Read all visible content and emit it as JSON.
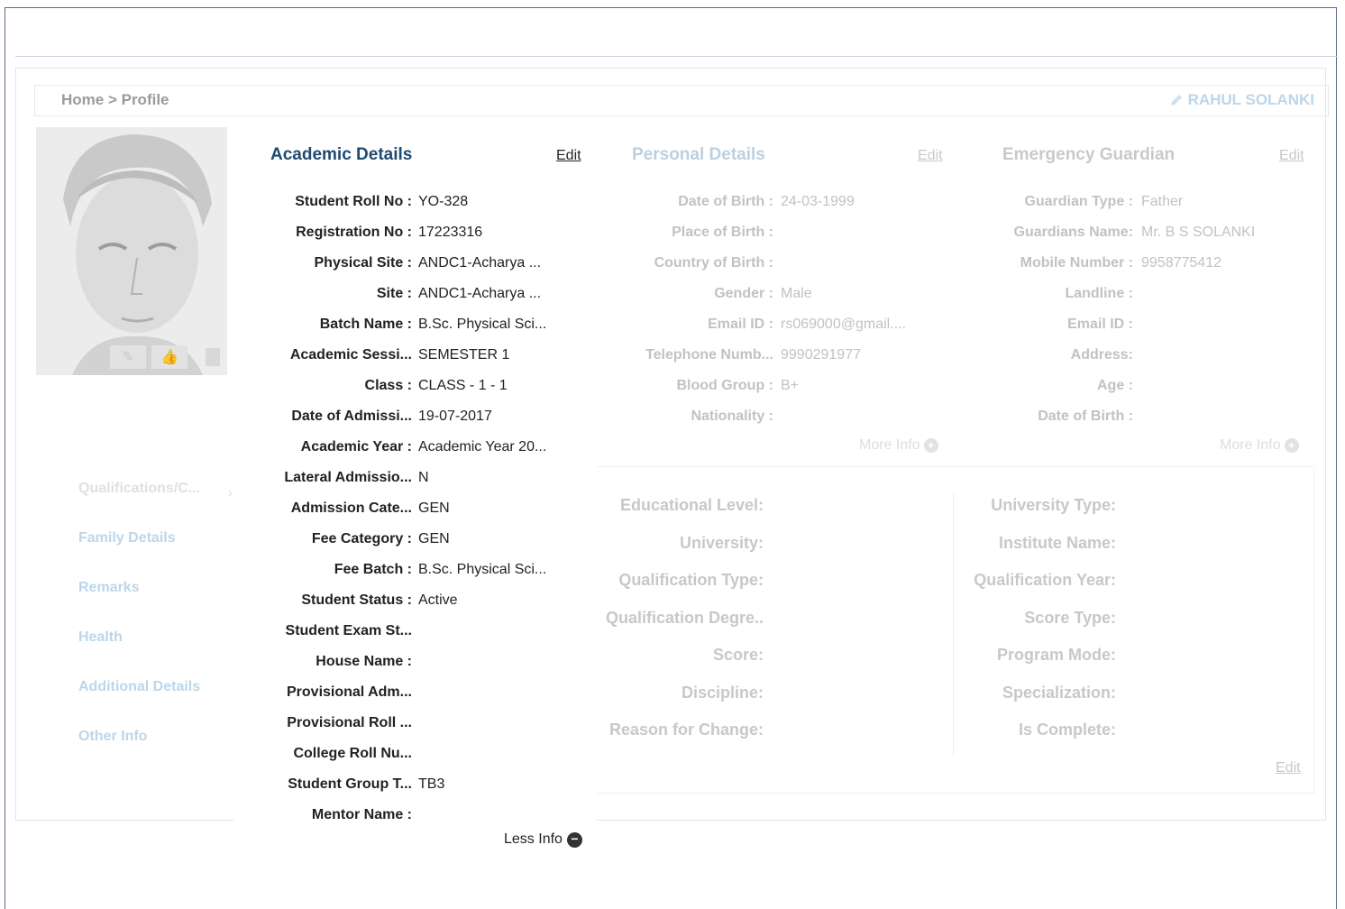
{
  "breadcrumb": "Home > Profile",
  "user": {
    "name": "RAHUL SOLANKI"
  },
  "sidenav": [
    "Qualifications/C...",
    "Family Details",
    "Remarks",
    "Health",
    "Additional Details",
    "Other Info"
  ],
  "academic": {
    "title": "Academic Details",
    "edit": "Edit",
    "rows": [
      {
        "label": "Student Roll No :",
        "value": "YO-328"
      },
      {
        "label": "Registration No :",
        "value": "17223316"
      },
      {
        "label": "Physical Site :",
        "value": "ANDC1-Acharya ..."
      },
      {
        "label": "Site :",
        "value": "ANDC1-Acharya ..."
      },
      {
        "label": "Batch Name :",
        "value": "B.Sc. Physical Sci..."
      },
      {
        "label": "Academic Sessi...",
        "value": "SEMESTER 1"
      },
      {
        "label": "Class :",
        "value": "CLASS - 1 - 1"
      },
      {
        "label": "Date of Admissi...",
        "value": "19-07-2017"
      },
      {
        "label": "Academic Year :",
        "value": "Academic Year 20..."
      },
      {
        "label": "Lateral Admissio...",
        "value": "N"
      },
      {
        "label": "Admission Cate...",
        "value": "GEN"
      },
      {
        "label": "Fee Category :",
        "value": "GEN"
      },
      {
        "label": "Fee Batch :",
        "value": "B.Sc. Physical Sci..."
      },
      {
        "label": "Student Status :",
        "value": "Active"
      },
      {
        "label": "Student Exam St...",
        "value": ""
      },
      {
        "label": "House Name :",
        "value": ""
      },
      {
        "label": "Provisional Adm...",
        "value": ""
      },
      {
        "label": "Provisional Roll ...",
        "value": ""
      },
      {
        "label": "College Roll Nu...",
        "value": ""
      },
      {
        "label": "Student Group T...",
        "value": "TB3"
      },
      {
        "label": "Mentor Name :",
        "value": ""
      }
    ],
    "less_info": "Less Info"
  },
  "personal": {
    "title": "Personal Details",
    "edit": "Edit",
    "rows": [
      {
        "label": "Date of Birth :",
        "value": "24-03-1999"
      },
      {
        "label": "Place of Birth :",
        "value": ""
      },
      {
        "label": "Country of Birth :",
        "value": ""
      },
      {
        "label": "Gender :",
        "value": "Male"
      },
      {
        "label": "Email ID :",
        "value": "rs069000@gmail...."
      },
      {
        "label": "Telephone Numb...",
        "value": "9990291977"
      },
      {
        "label": "Blood Group :",
        "value": "B+"
      },
      {
        "label": "Nationality :",
        "value": ""
      }
    ],
    "more_info": "More Info"
  },
  "guardian": {
    "title": "Emergency Guardian",
    "edit": "Edit",
    "rows": [
      {
        "label": "Guardian Type :",
        "value": "Father"
      },
      {
        "label": "Guardians Name:",
        "value": "Mr. B S SOLANKI"
      },
      {
        "label": "Mobile Number :",
        "value": "9958775412"
      },
      {
        "label": "Landline :",
        "value": ""
      },
      {
        "label": "Email ID :",
        "value": ""
      },
      {
        "label": "Address:",
        "value": ""
      },
      {
        "label": "Age :",
        "value": ""
      },
      {
        "label": "Date of Birth :",
        "value": ""
      }
    ],
    "more_info": "More Info"
  },
  "qualifications": {
    "left": [
      "Educational Level:",
      "University:",
      "Qualification Type:",
      "Qualification Degre..",
      "Score:",
      "Discipline:",
      "Reason for Change:"
    ],
    "right": [
      "University Type:",
      "Institute Name:",
      "Qualification Year:",
      "Score Type:",
      "Program Mode:",
      "Specialization:",
      "Is Complete:"
    ],
    "edit": "Edit"
  },
  "colors": {
    "accent": "#1f4a72",
    "faded_link": "#bcd6ea",
    "faded_text": "#c2c2c2"
  }
}
